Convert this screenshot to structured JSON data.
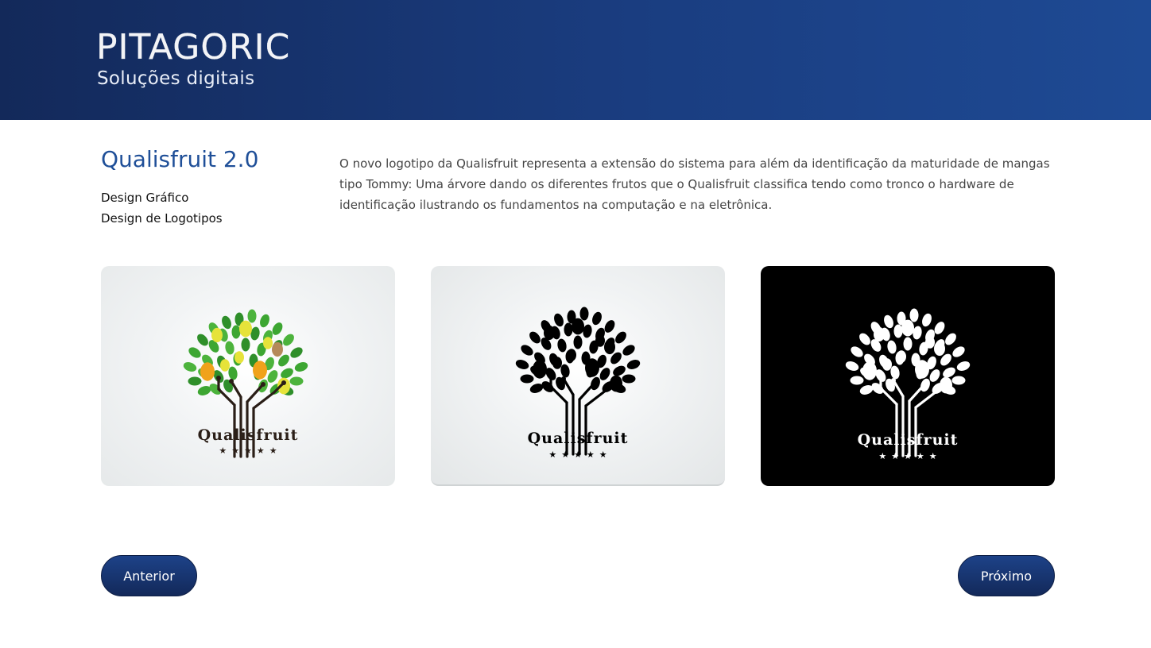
{
  "header": {
    "brand": "PITAGORIC",
    "tagline": "Soluções digitais"
  },
  "project": {
    "title": "Qualisfruit 2.0",
    "categories": [
      "Design Gráfico",
      "Design de Logotipos"
    ],
    "description": "O novo logotipo da Qualisfruit representa a extensão do sistema para além da identificação da maturidade de mangas tipo Tommy: Uma árvore dando os diferentes frutos que o Qualisfruit classifica tendo como tronco o hardware de identificação ilustrando os fundamentos na computação e na eletrônica."
  },
  "gallery": [
    {
      "variant": "color",
      "brand_text": "Qualisfruit",
      "stars": "★★★★★",
      "colors": {
        "leaf": "#3da632",
        "fruit_yellow": "#e6e33a",
        "fruit_orange": "#f0a21b",
        "fruit_brown": "#b58a5a",
        "trunk": "#2a1e17",
        "background": "#eef0f1"
      }
    },
    {
      "variant": "black",
      "brand_text": "Qualisfruit",
      "stars": "★★★★★",
      "colors": {
        "mark": "#000000",
        "background": "#eef0f1"
      }
    },
    {
      "variant": "white",
      "brand_text": "Qualisfruit",
      "stars": "★★★★★",
      "colors": {
        "mark": "#ffffff",
        "background": "#000000"
      }
    }
  ],
  "nav": {
    "previous_label": "Anterior",
    "next_label": "Próximo"
  },
  "colors": {
    "header_dark": "#13295a",
    "header_light": "#1e4a94",
    "title_blue": "#1f4f98"
  }
}
